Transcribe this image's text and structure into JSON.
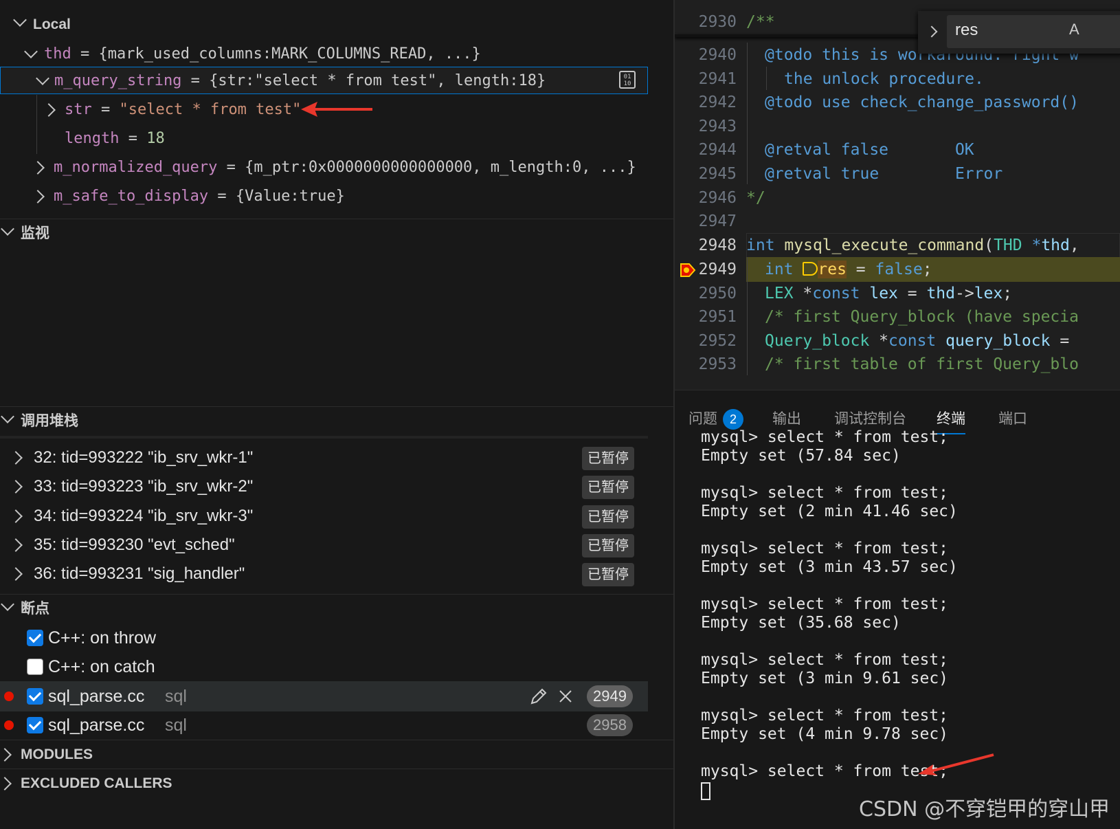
{
  "colors": {
    "accent": "#0078d4",
    "breakpoint": "#e51400",
    "arrow": "#e8372c"
  },
  "variables": {
    "section_title": "Local",
    "thd": {
      "name": "thd",
      "value": "{mark_used_columns:MARK_COLUMNS_READ, ...}"
    },
    "m_query_string": {
      "name": "m_query_string",
      "value": "{str:\"select * from test\", length:18}"
    },
    "str": {
      "name": "str",
      "value": "\"select * from test\""
    },
    "length": {
      "name": "length",
      "value": "18"
    },
    "m_normalized_query": {
      "name": "m_normalized_query",
      "value": "{m_ptr:0x0000000000000000, m_length:0, ...}"
    },
    "m_safe_to_display": {
      "name": "m_safe_to_display",
      "value": "{Value:true}"
    }
  },
  "watch": {
    "title": "监视"
  },
  "callstack": {
    "title": "调用堆栈",
    "paused_label": "已暂停",
    "threads": [
      "32: tid=993222 \"ib_srv_wkr-1\"",
      "33: tid=993223 \"ib_srv_wkr-2\"",
      "34: tid=993224 \"ib_srv_wkr-3\"",
      "35: tid=993230 \"evt_sched\"",
      "36: tid=993231 \"sig_handler\""
    ]
  },
  "breakpoints": {
    "title": "断点",
    "items": [
      {
        "label": "C++: on throw",
        "checked": true
      },
      {
        "label": "C++: on catch",
        "checked": false
      },
      {
        "file": "sql_parse.cc",
        "folder": "sql",
        "line": "2949",
        "checked": true
      },
      {
        "file": "sql_parse.cc",
        "folder": "sql",
        "line": "2958",
        "checked": true
      }
    ]
  },
  "modules": {
    "title": "MODULES"
  },
  "excluded_callers": {
    "title": "EXCLUDED CALLERS"
  },
  "editor": {
    "find_query": "res",
    "find_toggle": "A",
    "lines": [
      {
        "n": "2930",
        "t": "/**"
      },
      {
        "n": "2940",
        "t": "@todo this is workaround. right w"
      },
      {
        "n": "2941",
        "t": "the unlock procedure."
      },
      {
        "n": "2942",
        "t": "@todo use check_change_password()"
      },
      {
        "n": "2943",
        "t": ""
      },
      {
        "n": "2944",
        "t": "@retval false       OK"
      },
      {
        "n": "2945",
        "t": "@retval true        Error"
      },
      {
        "n": "2946",
        "t": "*/"
      },
      {
        "n": "2947",
        "t": ""
      },
      {
        "n": "2948",
        "t": "int mysql_execute_command(THD *thd,"
      },
      {
        "n": "2949",
        "t": "int res = false;"
      },
      {
        "n": "2950",
        "t": "LEX *const lex = thd->lex;"
      },
      {
        "n": "2951",
        "t": "/* first Query_block (have specia"
      },
      {
        "n": "2952",
        "t": "Query_block *const query_block ="
      },
      {
        "n": "2953",
        "t": "/* first table of first Query_blo"
      }
    ]
  },
  "panel": {
    "tabs": [
      {
        "label": "问题",
        "count": "2"
      },
      {
        "label": "输出"
      },
      {
        "label": "调试控制台"
      },
      {
        "label": "终端"
      },
      {
        "label": "端口"
      }
    ],
    "terminal": [
      "mysql> select * from test;",
      "Empty set (57.84 sec)",
      "",
      "mysql> select * from test;",
      "Empty set (2 min 41.46 sec)",
      "",
      "mysql> select * from test;",
      "Empty set (3 min 43.57 sec)",
      "",
      "mysql> select * from test;",
      "Empty set (35.68 sec)",
      "",
      "mysql> select * from test;",
      "Empty set (3 min 9.61 sec)",
      "",
      "mysql> select * from test;",
      "Empty set (4 min 9.78 sec)",
      "",
      "mysql> select * from test;"
    ]
  },
  "watermark": "CSDN @不穿铠甲的穿山甲"
}
